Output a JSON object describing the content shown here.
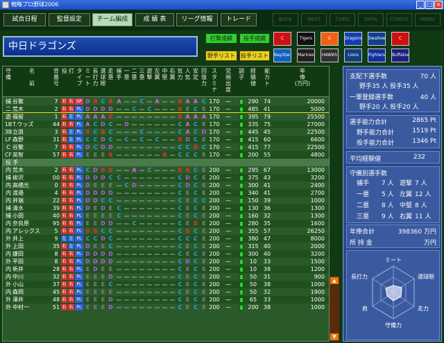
{
  "window": {
    "title": "戦略プロ野球2006"
  },
  "nav": [
    {
      "label": "試合日程"
    },
    {
      "label": "監督設定"
    },
    {
      "label": "チーム編成",
      "active": true
    },
    {
      "label": "成 績 表"
    },
    {
      "label": "リーグ情報"
    },
    {
      "label": "トレード"
    }
  ],
  "nav_right": [
    "BACK",
    "NEXT",
    "CARD",
    "DATA",
    "CONFIG",
    "MENU"
  ],
  "team_name": "中日ドラゴンズ",
  "buttons": {
    "batter_stats": "打撃成績",
    "pitcher_stats": "投手成績",
    "batter_list": "野手リスト",
    "pitcher_list": "投手リスト"
  },
  "logos": [
    "C",
    "Tigers",
    "G",
    "Dragons",
    "Swallows",
    "C",
    "BayStars",
    "Marines",
    "HAWKS",
    "Lions",
    "Fighters",
    "Buffaloes"
  ],
  "columns": [
    "守\n備",
    "名\n\n前",
    "背\n番\n号",
    "投",
    "打",
    "タ\nイ\nプ",
    "ミ\nー\nト",
    "長\n打\n力",
    "選\n球\n眼",
    "走\n塁",
    "捕\n手",
    "一\n塁",
    "二\n塁",
    "三\n塁",
    "遊\n撃",
    "左\n翼",
    "中\n堅",
    "右\n翼",
    "気\n力",
    "人\n気",
    "安\n定",
    "回\n復\n力",
    "ス\nタ\nミ\nナ",
    "党\n頻\n出\n度",
    "調\n子",
    "経\n験\n値",
    "能\nカ\nト",
    "年\n俸\n(万円)"
  ],
  "batters": [
    {
      "pos": "捕",
      "name": "谷繁",
      "num": "7",
      "t": "右",
      "b": "右",
      "type": "SP",
      "meet": "D",
      "pow": "B",
      "eye": "C",
      "run": "B",
      "c": "A",
      "b1": "—",
      "b2": "—",
      "b3": "C",
      "ss": "—",
      "lf": "A",
      "cf": "—",
      "rf": "—",
      "spirit": "B",
      "pop": "A",
      "stab": "A",
      "rec": "C",
      "sta": "170",
      "freq": "—",
      "exp": "290",
      "abil": "74",
      "sal": "20000"
    },
    {
      "pos": "二",
      "name": "荒木",
      "num": "2",
      "t": "右",
      "b": "右",
      "type": "PL",
      "meet": "D",
      "pow": "D",
      "eye": "D",
      "run": "D",
      "c": "—",
      "b1": "—",
      "b2": "C",
      "b3": "—",
      "ss": "C",
      "lf": "—",
      "cf": "—",
      "rf": "—",
      "spirit": "B",
      "pop": "E",
      "stab": "C",
      "rec": "E",
      "sta": "170",
      "freq": "—",
      "exp": "485",
      "abil": "41",
      "sal": "5000"
    },
    {
      "pos": "遊",
      "name": "福留",
      "num": "1",
      "t": "右",
      "b": "左",
      "type": "PL",
      "meet": "A",
      "pow": "A",
      "eye": "A",
      "run": "B",
      "c": "—",
      "b1": "—",
      "b2": "—",
      "b3": "—",
      "ss": "—",
      "lf": "—",
      "cf": "—",
      "rf": "—",
      "spirit": "B",
      "pop": "A",
      "stab": "A",
      "rec": "A",
      "sta": "170",
      "freq": "—",
      "exp": "395",
      "abil": "79",
      "sal": "25500"
    },
    {
      "pos": "1B",
      "name": "T.ウッズ",
      "num": "44",
      "t": "右",
      "b": "右",
      "type": "PL",
      "meet": "A",
      "pow": "C",
      "eye": "D",
      "run": "C",
      "c": "—",
      "b1": "D",
      "b2": "—",
      "b3": "—",
      "ss": "—",
      "lf": "—",
      "cf": "—",
      "rf": "—",
      "spirit": "C",
      "pop": "A",
      "stab": "C",
      "rec": "E",
      "sta": "170",
      "freq": "—",
      "exp": "335",
      "abil": "75",
      "sal": "27000"
    },
    {
      "pos": "3B",
      "name": "立浪",
      "num": "3",
      "t": "右",
      "b": "左",
      "type": "PL",
      "meet": "B",
      "pow": "C",
      "eye": "B",
      "run": "C",
      "c": "—",
      "b1": "—",
      "b2": "—",
      "b3": "C",
      "ss": "—",
      "lf": "—",
      "cf": "—",
      "rf": "—",
      "spirit": "C",
      "pop": "A",
      "stab": "C",
      "rec": "D",
      "sta": "170",
      "freq": "—",
      "exp": "445",
      "abil": "45",
      "sal": "22500"
    },
    {
      "pos": "LF",
      "name": "森野",
      "num": "31",
      "t": "右",
      "b": "左",
      "type": "PL",
      "meet": "C",
      "pow": "C",
      "eye": "D",
      "run": "C",
      "c": "—",
      "b1": "C",
      "b2": "—",
      "b3": "C",
      "ss": "—",
      "lf": "C",
      "cf": "—",
      "rf": "—",
      "spirit": "B",
      "pop": "D",
      "stab": "C",
      "rec": "E",
      "sta": "170",
      "freq": "—",
      "exp": "415",
      "abil": "60",
      "sal": "6600"
    },
    {
      "pos": "C",
      "name": "谷繁",
      "num": "7",
      "t": "右",
      "b": "右",
      "type": "PL",
      "meet": "D",
      "pow": "C",
      "eye": "D",
      "run": "D",
      "c": "—",
      "b1": "—",
      "b2": "—",
      "b3": "—",
      "ss": "—",
      "lf": "—",
      "cf": "—",
      "rf": "—",
      "spirit": "C",
      "pop": "C",
      "stab": "B",
      "rec": "C",
      "sta": "170",
      "freq": "—",
      "exp": "415",
      "abil": "77",
      "sal": "22500"
    },
    {
      "pos": "CF",
      "name": "英智",
      "num": "57",
      "t": "右",
      "b": "右",
      "type": "PL",
      "meet": "E",
      "pow": "E",
      "eye": "E",
      "run": "B",
      "c": "—",
      "b1": "—",
      "b2": "—",
      "b3": "—",
      "ss": "—",
      "lf": "—",
      "cf": "B",
      "rf": "—",
      "spirit": "C",
      "pop": "C",
      "stab": "C",
      "rec": "E",
      "sta": "170",
      "freq": "—",
      "exp": "200",
      "abil": "55",
      "sal": "4800"
    }
  ],
  "section_label": "投 手",
  "pitchers": [
    {
      "pos": "内",
      "name": "荒木",
      "num": "2",
      "t": "右",
      "b": "右",
      "type": "PL",
      "meet": "C",
      "pow": "D",
      "eye": "B",
      "run": "B",
      "c": "—",
      "b1": "—",
      "b2": "A",
      "b3": "—",
      "ss": "C",
      "lf": "—",
      "cf": "—",
      "rf": "—",
      "spirit": "B",
      "pop": "B",
      "stab": "C",
      "rec": "E",
      "sta": "200",
      "freq": "—",
      "exp": "295",
      "abil": "67",
      "sal": "13000"
    },
    {
      "pos": "捕",
      "name": "柳沢",
      "num": "00",
      "t": "右",
      "b": "右",
      "type": "PL",
      "meet": "D",
      "pow": "D",
      "eye": "D",
      "run": "C",
      "c": "C",
      "b1": "—",
      "b2": "—",
      "b3": "—",
      "ss": "—",
      "lf": "—",
      "cf": "—",
      "rf": "—",
      "spirit": "C",
      "pop": "D",
      "stab": "C",
      "rec": "E",
      "sta": "200",
      "freq": "—",
      "exp": "375",
      "abil": "43",
      "sal": "3200"
    },
    {
      "pos": "内",
      "name": "高橋光",
      "num": "0",
      "t": "右",
      "b": "右",
      "type": "PL",
      "meet": "D",
      "pow": "E",
      "eye": "E",
      "run": "E",
      "c": "—",
      "b1": "C",
      "b2": "D",
      "b3": "—",
      "ss": "—",
      "lf": "—",
      "cf": "—",
      "rf": "—",
      "spirit": "C",
      "pop": "D",
      "stab": "C",
      "rec": "E",
      "sta": "200",
      "freq": "—",
      "exp": "300",
      "abil": "41",
      "sal": "2400"
    },
    {
      "pos": "内",
      "name": "渡邉",
      "num": "4",
      "t": "右",
      "b": "右",
      "type": "PL",
      "meet": "D",
      "pow": "D",
      "eye": "D",
      "run": "D",
      "c": "—",
      "b1": "—",
      "b2": "—",
      "b3": "—",
      "ss": "—",
      "lf": "—",
      "cf": "—",
      "rf": "—",
      "spirit": "C",
      "pop": "E",
      "stab": "C",
      "rec": "E",
      "sta": "200",
      "freq": "—",
      "exp": "340",
      "abil": "41",
      "sal": "2700"
    },
    {
      "pos": "内",
      "name": "井端",
      "num": "22",
      "t": "右",
      "b": "右",
      "type": "PL",
      "meet": "D",
      "pow": "D",
      "eye": "C",
      "run": "C",
      "c": "—",
      "b1": "—",
      "b2": "—",
      "b3": "—",
      "ss": "—",
      "lf": "—",
      "cf": "—",
      "rf": "—",
      "spirit": "C",
      "pop": "E",
      "stab": "C",
      "rec": "C",
      "sta": "200",
      "freq": "—",
      "exp": "150",
      "abil": "39",
      "sal": "1000"
    },
    {
      "pos": "捕",
      "name": "清水",
      "num": "39",
      "t": "右",
      "b": "右",
      "type": "PL",
      "meet": "D",
      "pow": "E",
      "eye": "D",
      "run": "E",
      "c": "C",
      "b1": "—",
      "b2": "—",
      "b3": "—",
      "ss": "—",
      "lf": "—",
      "cf": "—",
      "rf": "—",
      "spirit": "C",
      "pop": "E",
      "stab": "C",
      "rec": "E",
      "sta": "200",
      "freq": "—",
      "exp": "130",
      "abil": "36",
      "sal": "1300"
    },
    {
      "pos": "捕",
      "name": "小田",
      "num": "40",
      "t": "右",
      "b": "右",
      "type": "PL",
      "meet": "E",
      "pow": "E",
      "eye": "E",
      "run": "E",
      "c": "C",
      "b1": "—",
      "b2": "—",
      "b3": "—",
      "ss": "—",
      "lf": "—",
      "cf": "—",
      "rf": "—",
      "spirit": "C",
      "pop": "E",
      "stab": "C",
      "rec": "E",
      "sta": "200",
      "freq": "—",
      "exp": "160",
      "abil": "32",
      "sal": "1300"
    },
    {
      "pos": "内",
      "name": "奈良原",
      "num": "95",
      "t": "右",
      "b": "右",
      "type": "PL",
      "meet": "E",
      "pow": "E",
      "eye": "D",
      "run": "D",
      "c": "—",
      "b1": "—",
      "b2": "C",
      "b3": "—",
      "ss": "—",
      "lf": "—",
      "cf": "—",
      "rf": "—",
      "spirit": "C",
      "pop": "E",
      "stab": "B",
      "rec": "E",
      "sta": "200",
      "freq": "—",
      "exp": "280",
      "abil": "35",
      "sal": "1600"
    },
    {
      "pos": "内",
      "name": "アレックス",
      "num": "5",
      "t": "右",
      "b": "右",
      "type": "PL",
      "meet": "B",
      "pow": "B",
      "eye": "C",
      "run": "C",
      "c": "—",
      "b1": "—",
      "b2": "—",
      "b3": "—",
      "ss": "—",
      "lf": "—",
      "cf": "—",
      "rf": "—",
      "spirit": "C",
      "pop": "B",
      "stab": "C",
      "rec": "E",
      "sta": "200",
      "freq": "—",
      "exp": "355",
      "abil": "57",
      "sal": "26250"
    },
    {
      "pos": "外",
      "name": "井上",
      "num": "9",
      "t": "左",
      "b": "左",
      "type": "PL",
      "meet": "C",
      "pow": "C",
      "eye": "D",
      "run": "C",
      "c": "—",
      "b1": "—",
      "b2": "—",
      "b3": "—",
      "ss": "—",
      "lf": "—",
      "cf": "—",
      "rf": "—",
      "spirit": "C",
      "pop": "C",
      "stab": "C",
      "rec": "E",
      "sta": "200",
      "freq": "—",
      "exp": "380",
      "abil": "47",
      "sal": "8000"
    },
    {
      "pos": "外",
      "name": "上田",
      "num": "35",
      "t": "右",
      "b": "左",
      "type": "PL",
      "meet": "D",
      "pow": "E",
      "eye": "E",
      "run": "C",
      "c": "—",
      "b1": "—",
      "b2": "—",
      "b3": "—",
      "ss": "—",
      "lf": "—",
      "cf": "—",
      "rf": "—",
      "spirit": "C",
      "pop": "E",
      "stab": "C",
      "rec": "E",
      "sta": "200",
      "freq": "—",
      "exp": "315",
      "abil": "40",
      "sal": "2000"
    },
    {
      "pos": "内",
      "name": "鎌田",
      "num": "8",
      "t": "右",
      "b": "右",
      "type": "PL",
      "meet": "D",
      "pow": "D",
      "eye": "D",
      "run": "D",
      "c": "—",
      "b1": "—",
      "b2": "—",
      "b3": "—",
      "ss": "—",
      "lf": "—",
      "cf": "—",
      "rf": "—",
      "spirit": "C",
      "pop": "E",
      "stab": "C",
      "rec": "E",
      "sta": "200",
      "freq": "—",
      "exp": "300",
      "abil": "40",
      "sal": "3200"
    },
    {
      "pos": "外",
      "name": "平田",
      "num": "8",
      "t": "右",
      "b": "右",
      "type": "PL",
      "meet": "D",
      "pow": "D",
      "eye": "D",
      "run": "D",
      "c": "—",
      "b1": "—",
      "b2": "—",
      "b3": "—",
      "ss": "—",
      "lf": "—",
      "cf": "—",
      "rf": "—",
      "spirit": "C",
      "pop": "D",
      "stab": "C",
      "rec": "E",
      "sta": "200",
      "freq": "—",
      "exp": "10",
      "abil": "33",
      "sal": "1500"
    },
    {
      "pos": "内",
      "name": "新井",
      "num": "28",
      "t": "右",
      "b": "右",
      "type": "PL",
      "meet": "E",
      "pow": "D",
      "eye": "E",
      "run": "E",
      "c": "—",
      "b1": "—",
      "b2": "—",
      "b3": "—",
      "ss": "—",
      "lf": "—",
      "cf": "—",
      "rf": "—",
      "spirit": "C",
      "pop": "E",
      "stab": "C",
      "rec": "E",
      "sta": "200",
      "freq": "—",
      "exp": "10",
      "abil": "38",
      "sal": "1200"
    },
    {
      "pos": "内",
      "name": "中川",
      "num": "32",
      "t": "右",
      "b": "右",
      "type": "PL",
      "meet": "E",
      "pow": "E",
      "eye": "E",
      "run": "D",
      "c": "—",
      "b1": "—",
      "b2": "—",
      "b3": "—",
      "ss": "—",
      "lf": "—",
      "cf": "—",
      "rf": "—",
      "spirit": "C",
      "pop": "E",
      "stab": "C",
      "rec": "E",
      "sta": "200",
      "freq": "—",
      "exp": "50",
      "abil": "31",
      "sal": "900"
    },
    {
      "pos": "外",
      "name": "小山",
      "num": "37",
      "t": "右",
      "b": "右",
      "type": "PL",
      "meet": "E",
      "pow": "E",
      "eye": "E",
      "run": "C",
      "c": "—",
      "b1": "—",
      "b2": "—",
      "b3": "—",
      "ss": "—",
      "lf": "—",
      "cf": "—",
      "rf": "—",
      "spirit": "C",
      "pop": "E",
      "stab": "C",
      "rec": "E",
      "sta": "200",
      "freq": "—",
      "exp": "50",
      "abil": "38",
      "sal": "1000"
    },
    {
      "pos": "内",
      "name": "森岡",
      "num": "45",
      "t": "右",
      "b": "右",
      "type": "PL",
      "meet": "E",
      "pow": "E",
      "eye": "E",
      "run": "E",
      "c": "—",
      "b1": "—",
      "b2": "—",
      "b3": "—",
      "ss": "—",
      "lf": "—",
      "cf": "—",
      "rf": "—",
      "spirit": "C",
      "pop": "E",
      "stab": "C",
      "rec": "E",
      "sta": "200",
      "freq": "—",
      "exp": "50",
      "abil": "32",
      "sal": "1900"
    },
    {
      "pos": "外",
      "name": "澤井",
      "num": "48",
      "t": "右",
      "b": "右",
      "type": "PL",
      "meet": "E",
      "pow": "E",
      "eye": "E",
      "run": "D",
      "c": "—",
      "b1": "—",
      "b2": "—",
      "b3": "—",
      "ss": "—",
      "lf": "—",
      "cf": "—",
      "rf": "—",
      "spirit": "C",
      "pop": "E",
      "stab": "C",
      "rec": "E",
      "sta": "200",
      "freq": "—",
      "exp": "65",
      "abil": "33",
      "sal": "1000"
    },
    {
      "pos": "外",
      "name": "中村一",
      "num": "51",
      "t": "右",
      "b": "右",
      "type": "PL",
      "meet": "E",
      "pow": "E",
      "eye": "E",
      "run": "D",
      "c": "—",
      "b1": "—",
      "b2": "—",
      "b3": "—",
      "ss": "—",
      "lf": "—",
      "cf": "—",
      "rf": "—",
      "spirit": "C",
      "pop": "E",
      "stab": "C",
      "rec": "E",
      "sta": "200",
      "freq": "—",
      "exp": "200",
      "abil": "38",
      "sal": "1000"
    }
  ],
  "summary": {
    "rows": [
      {
        "label": "支配下選手数",
        "value": "70 人"
      },
      {
        "label": "野手35 人 投手35 人",
        "value": ""
      },
      {
        "label": "一軍登録選手数",
        "value": "40 人"
      },
      {
        "label": "野手20 人 投手20 人",
        "value": ""
      }
    ],
    "ability": [
      {
        "label": "選手能力合計",
        "value": "2865 Pt"
      },
      {
        "label": "野手能力合計",
        "value": "1519 Pt"
      },
      {
        "label": "投手能力合計",
        "value": "1346 Pt"
      }
    ],
    "exp": {
      "label": "平均経験値",
      "value": "232"
    },
    "defense_title": "守備別選手数",
    "defense": [
      {
        "a": "捕手",
        "av": "7 人",
        "b": "遊撃",
        "bv": "7 人"
      },
      {
        "a": "一塁",
        "av": "5 人",
        "b": "左翼",
        "bv": "12 人"
      },
      {
        "a": "二塁",
        "av": "8 人",
        "b": "中堅",
        "bv": "8 人"
      },
      {
        "a": "三塁",
        "av": "9 人",
        "b": "右翼",
        "bv": "11 人"
      }
    ],
    "salary_total": {
      "label": "年俸合計",
      "value": "398360 万円"
    },
    "money": {
      "label": "所 持 金",
      "value": "万円"
    }
  },
  "radar": {
    "labels": [
      "ミート",
      "選球眼",
      "走力",
      "守備力",
      "肩",
      "長打力"
    ]
  }
}
